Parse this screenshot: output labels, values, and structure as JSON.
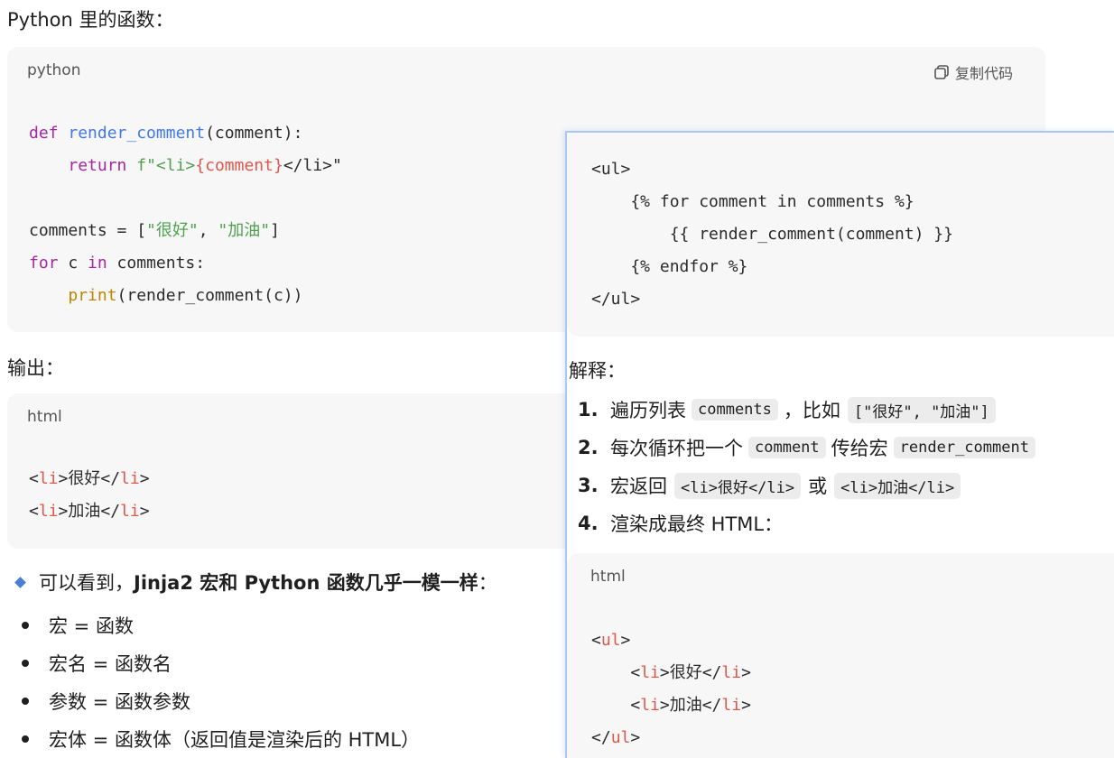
{
  "left": {
    "heading1": "Python 里的函数：",
    "block1": {
      "lang": "python",
      "copy_label": "复制代码",
      "lines": {
        "l1_kw": "def",
        "l1_fn": "render_comment",
        "l1_rest": "(comment):",
        "l2_kw": "return",
        "l2_str1": "f\"<li>",
        "l2_tag": "{comment}",
        "l2_str2": "</li>\"",
        "l4_a": "comments = [",
        "l4_s1": "\"很好\"",
        "l4_b": ", ",
        "l4_s2": "\"加油\"",
        "l4_c": "]",
        "l5_kw1": "for",
        "l5_a": " c ",
        "l5_kw2": "in",
        "l5_b": " comments:",
        "l6_bi": "print",
        "l6_rest": "(render_comment(c))"
      }
    },
    "heading2": "输出：",
    "block2": {
      "lang": "html",
      "l1_a": "<",
      "l1_tag1": "li",
      "l1_b": ">很好</",
      "l1_tag2": "li",
      "l1_c": ">",
      "l2_a": "<",
      "l2_tag1": "li",
      "l2_b": ">加油</",
      "l2_tag2": "li",
      "l2_c": ">"
    },
    "summary": {
      "pre": "可以看到，",
      "bold": "Jinja2 宏和 Python 函数几乎一模一样",
      "post": "："
    },
    "bullets": [
      "宏 = 函数",
      "宏名 = 函数名",
      "参数 = 函数参数",
      "宏体 = 函数体（返回值是渲染后的 HTML）"
    ]
  },
  "overlay": {
    "code_lines": [
      "<ul>",
      "    {% for comment in comments %}",
      "        {{ render_comment(comment) }}",
      "    {% endfor %}",
      "</ul>"
    ],
    "heading": "解释：",
    "steps": [
      {
        "num": "1.",
        "a": "遍历列表",
        "code1": "comments",
        "b": "，比如",
        "code2": "[\"很好\", \"加油\"]"
      },
      {
        "num": "2.",
        "a": "每次循环把一个",
        "code1": "comment",
        "b": "传给宏",
        "code2": "render_comment"
      },
      {
        "num": "3.",
        "a": "宏返回",
        "code1": "<li>很好</li>",
        "b": "或",
        "code2": "<li>加油</li>"
      },
      {
        "num": "4.",
        "a": "渲染成最终 HTML："
      }
    ],
    "block": {
      "lang": "html",
      "ul_open_a": "<",
      "ul_open_tag": "ul",
      "ul_open_b": ">",
      "r1_a": "    <",
      "r1_t1": "li",
      "r1_b": ">很好</",
      "r1_t2": "li",
      "r1_c": ">",
      "r2_a": "    <",
      "r2_t1": "li",
      "r2_b": ">加油</",
      "r2_t2": "li",
      "r2_c": ">",
      "ul_close_a": "</",
      "ul_close_tag": "ul",
      "ul_close_b": ">"
    }
  },
  "colors": {
    "accent_bullet": "#4a7fd6",
    "overlay_border": "#a9c8f5"
  }
}
